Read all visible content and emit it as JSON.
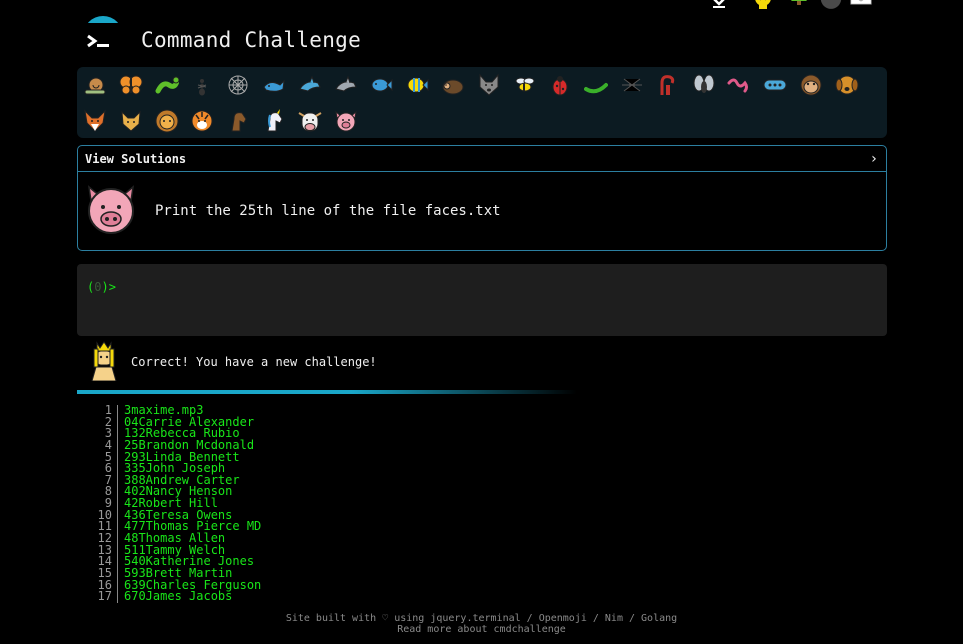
{
  "header": {
    "title": "Command Challenge",
    "logo_icon": "terminal-prompt-icon"
  },
  "top_icons": [
    "download-icon",
    "bulb-icon",
    "tree-icon",
    "shield-icon",
    "mail-icon"
  ],
  "animals": {
    "row1": [
      "snail-icon",
      "butterfly-icon",
      "bug-icon",
      "ant-icon",
      "spider-web-icon",
      "whale-icon",
      "dolphin-icon",
      "dolphin-grey-icon",
      "fish-icon",
      "tropical-fish-icon",
      "hedgehog-icon",
      "wolf-icon",
      "honeybee-icon",
      "ladybug-icon",
      "caterpillar-icon",
      "spider-icon",
      "scorpion-icon",
      "fly-icon",
      "worm-icon",
      "microbe-icon",
      "monkey-icon",
      "dog-icon"
    ],
    "row2": [
      "fox-icon",
      "cat-icon",
      "lion-icon",
      "tiger-icon",
      "horse-icon",
      "unicorn-icon",
      "cow-icon",
      "pig-icon"
    ]
  },
  "solutions_panel": {
    "label": "View Solutions",
    "chevron": "›",
    "challenge_text": "Print the 25th line of the file faces.txt",
    "challenge_icon": "pig-face-icon"
  },
  "terminal": {
    "prompt_open": "(",
    "prompt_number": "0",
    "prompt_close": ")>"
  },
  "result": {
    "message": "Correct! You have a new challenge!",
    "icon": "princess-icon"
  },
  "listing": [
    {
      "n": "1",
      "text": "3maxime.mp3"
    },
    {
      "n": "2",
      "text": "04Carrie Alexander"
    },
    {
      "n": "3",
      "text": "132Rebecca Rubio"
    },
    {
      "n": "4",
      "text": "25Brandon Mcdonald"
    },
    {
      "n": "5",
      "text": "293Linda Bennett"
    },
    {
      "n": "6",
      "text": "335John Joseph"
    },
    {
      "n": "7",
      "text": "388Andrew Carter"
    },
    {
      "n": "8",
      "text": "402Nancy Henson"
    },
    {
      "n": "9",
      "text": "42Robert Hill"
    },
    {
      "n": "10",
      "text": "436Teresa Owens"
    },
    {
      "n": "11",
      "text": "477Thomas Pierce MD"
    },
    {
      "n": "12",
      "text": "48Thomas Allen"
    },
    {
      "n": "13",
      "text": "511Tammy Welch"
    },
    {
      "n": "14",
      "text": "540Katherine Jones"
    },
    {
      "n": "15",
      "text": "593Brett Martin"
    },
    {
      "n": "16",
      "text": "639Charles Ferguson"
    },
    {
      "n": "17",
      "text": "670James Jacobs"
    }
  ],
  "footer": {
    "line1": "Site built with ♡ using jquery.terminal / Openmoji / Nim / Golang",
    "line2": "Read more about cmdchallenge"
  }
}
